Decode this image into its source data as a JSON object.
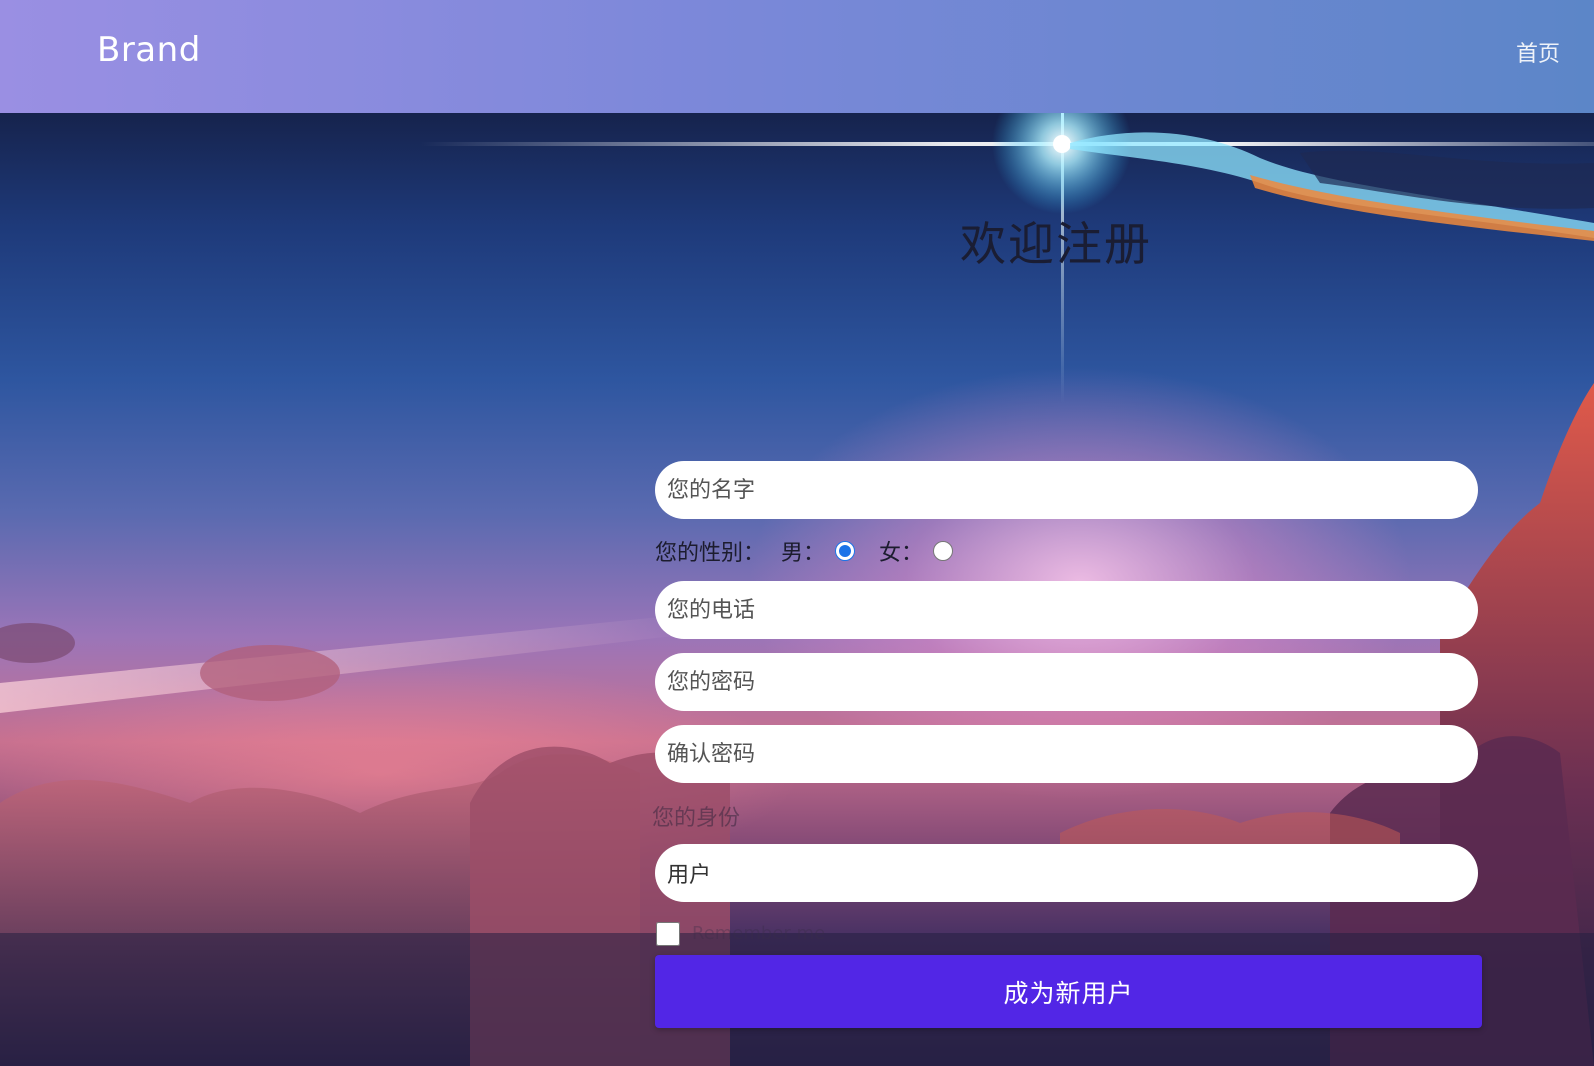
{
  "navbar": {
    "brand": "Brand",
    "home_link": "首页"
  },
  "form": {
    "title": "欢迎注册",
    "name_placeholder": "您的名字",
    "gender_label": "您的性别：",
    "gender_options": [
      {
        "label": "男：",
        "checked": true
      },
      {
        "label": "女：",
        "checked": false
      }
    ],
    "phone_placeholder": "您的电话",
    "password_placeholder": "您的密码",
    "confirm_placeholder": "确认密码",
    "role_label": "您的身份",
    "role_value": "用户",
    "remember_label": "Remember me",
    "submit_label": "成为新用户"
  },
  "colors": {
    "navbar_gradient": [
      "#9a8fe3",
      "#5c86c8"
    ],
    "submit_button": "#5226e6",
    "radio_accent": "#1a73e8"
  }
}
